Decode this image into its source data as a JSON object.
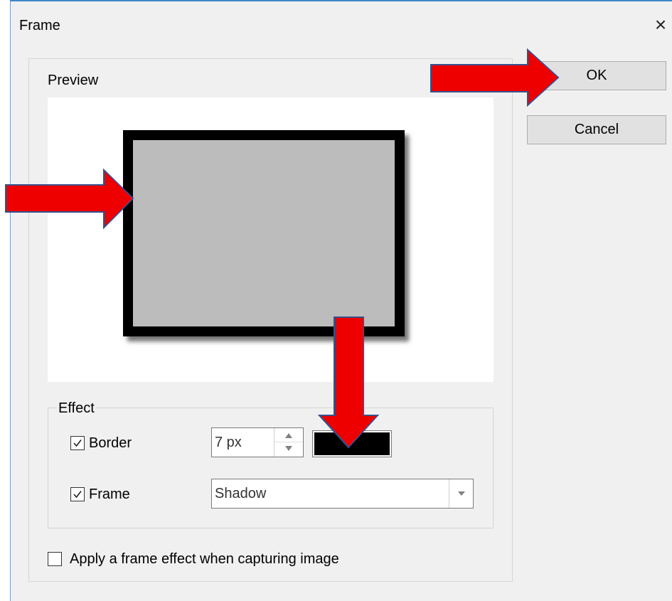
{
  "dialog": {
    "title": "Frame",
    "close_glyph": "×"
  },
  "preview": {
    "label": "Preview",
    "frame_fill_color": "#bcbcbc",
    "frame_border_color": "#000000"
  },
  "buttons": {
    "ok_label": "OK",
    "cancel_label": "Cancel"
  },
  "effect": {
    "group_label": "Effect",
    "border": {
      "label": "Border",
      "checked": true,
      "width_value": "7 px",
      "color": "#000000"
    },
    "frame": {
      "label": "Frame",
      "checked": true,
      "selected_option": "Shadow"
    }
  },
  "apply_capture": {
    "label": "Apply a frame effect when capturing image",
    "checked": false
  },
  "annotations": {
    "arrow_color": "#ee0000",
    "arrow_outline": "#3a4f8a"
  }
}
